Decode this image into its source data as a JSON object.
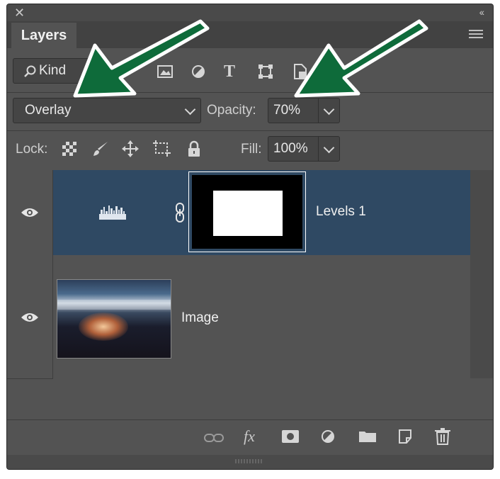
{
  "panel": {
    "tab_label": "Layers"
  },
  "filter": {
    "kind_label": "Kind"
  },
  "blend": {
    "mode": "Overlay",
    "opacity_label": "Opacity:",
    "opacity_value": "70%"
  },
  "lock": {
    "lock_label": "Lock:",
    "fill_label": "Fill:",
    "fill_value": "100%"
  },
  "layers": [
    {
      "name": "Levels 1",
      "selected": true
    },
    {
      "name": "Image",
      "selected": false
    }
  ],
  "footer": {
    "fx_label": "fx"
  }
}
